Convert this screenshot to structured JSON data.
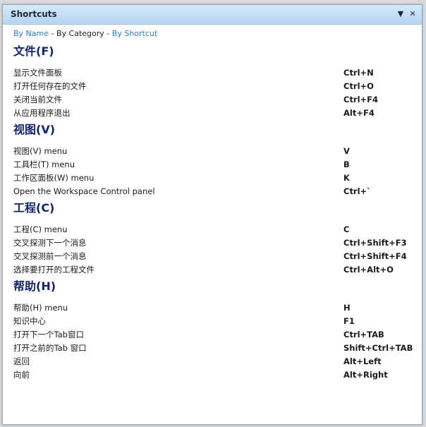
{
  "panel": {
    "title": "Shortcuts",
    "dropdown_glyph": "▼",
    "close_glyph": "✕"
  },
  "nav": {
    "by_name": "By Name",
    "separator": "-",
    "by_category": "By Category",
    "by_shortcut": "By Shortcut"
  },
  "sections": [
    {
      "title": "文件(F)",
      "rows": [
        {
          "desc": "显示文件面板",
          "key": "Ctrl+N"
        },
        {
          "desc": "打开任何存在的文件",
          "key": "Ctrl+O"
        },
        {
          "desc": "关闭当前文件",
          "key": "Ctrl+F4"
        },
        {
          "desc": "从应用程序退出",
          "key": "Alt+F4"
        }
      ]
    },
    {
      "title": "视图(V)",
      "rows": [
        {
          "desc": "视图(V) menu",
          "key": "V"
        },
        {
          "desc": "工具栏(T) menu",
          "key": "B"
        },
        {
          "desc": "工作区面板(W) menu",
          "key": "K"
        },
        {
          "desc": "Open the Workspace Control panel",
          "key": "Ctrl+`"
        }
      ]
    },
    {
      "title": "工程(C)",
      "rows": [
        {
          "desc": "工程(C) menu",
          "key": "C"
        },
        {
          "desc": "交叉探测下一个消息",
          "key": "Ctrl+Shift+F3"
        },
        {
          "desc": "交叉探测前一个消息",
          "key": "Ctrl+Shift+F4"
        },
        {
          "desc": "选择要打开的工程文件",
          "key": "Ctrl+Alt+O"
        }
      ]
    },
    {
      "title": "帮助(H)",
      "rows": [
        {
          "desc": "帮助(H) menu",
          "key": "H"
        },
        {
          "desc": "知识中心",
          "key": "F1"
        },
        {
          "desc": "打开下一个Tab窗口",
          "key": "Ctrl+TAB"
        },
        {
          "desc": "打开之前的Tab 窗口",
          "key": "Shift+Ctrl+TAB"
        },
        {
          "desc": "返回",
          "key": "Alt+Left"
        },
        {
          "desc": "向前",
          "key": "Alt+Right"
        }
      ]
    }
  ]
}
